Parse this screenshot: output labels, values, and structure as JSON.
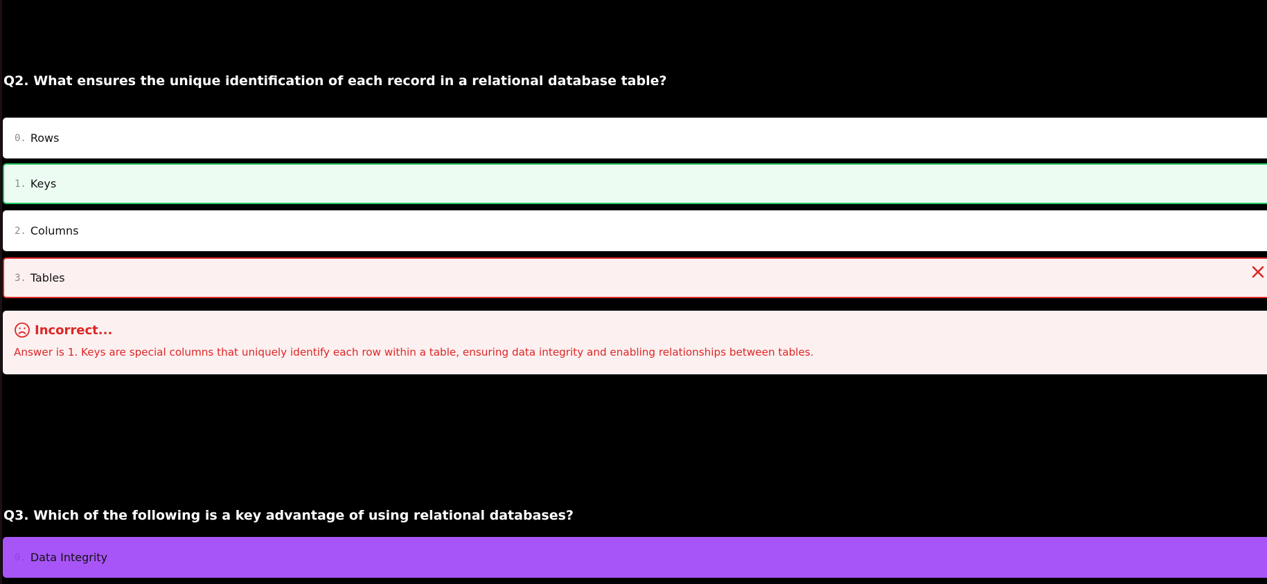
{
  "q2": {
    "title": "Q2. What ensures the unique identification of each record in a relational database table?",
    "options": [
      {
        "index": "0.",
        "label": "Rows",
        "state": "default"
      },
      {
        "index": "1.",
        "label": "Keys",
        "state": "correct"
      },
      {
        "index": "2.",
        "label": "Columns",
        "state": "default"
      },
      {
        "index": "3.",
        "label": "Tables",
        "state": "wrong"
      }
    ],
    "feedback": {
      "heading": "Incorrect...",
      "text": "Answer is 1. Keys are special columns that uniquely identify each row within a table, ensuring data integrity and enabling relationships between tables."
    }
  },
  "q3": {
    "title": "Q3. Which of the following is a key advantage of using relational databases?",
    "options": [
      {
        "index": "0.",
        "label": "Data Integrity",
        "state": "selected"
      }
    ]
  },
  "colors": {
    "background": "#000000",
    "correct_border": "#22c55e",
    "correct_bg": "#edfcf3",
    "wrong_border": "#dc2626",
    "wrong_bg": "#fdf0f0",
    "selected_bg": "#a855f7"
  },
  "icons": {
    "wrong_mark": "close-icon",
    "feedback": "sad-face-icon"
  }
}
